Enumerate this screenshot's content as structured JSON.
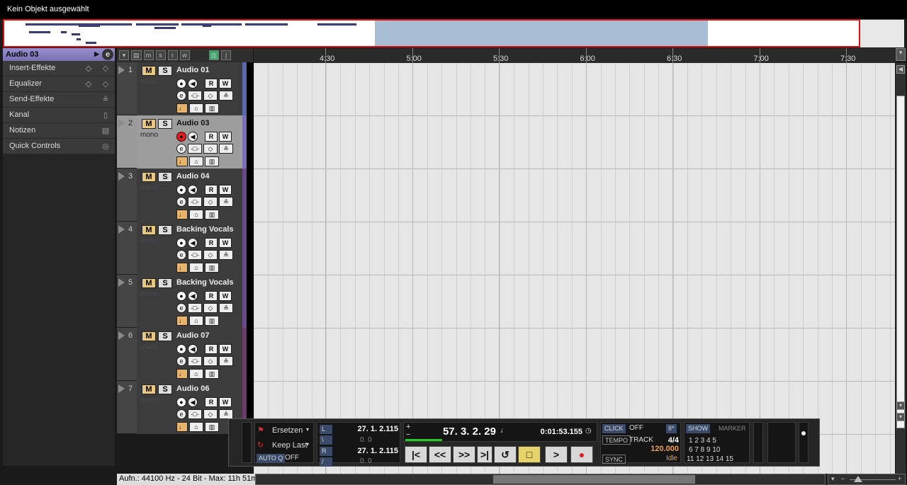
{
  "status_title": "Kein Objekt ausgewählt",
  "inspector": {
    "track_name": "Audio 03",
    "items": [
      {
        "label": "Insert-Effekte",
        "icon": "insert-icon"
      },
      {
        "label": "Equalizer",
        "icon": "eq-icon"
      },
      {
        "label": "Send-Effekte",
        "icon": "send-icon"
      },
      {
        "label": "Kanal",
        "icon": "channel-icon"
      },
      {
        "label": "Notizen",
        "icon": "notes-icon"
      },
      {
        "label": "Quick Controls",
        "icon": "quick-controls-icon"
      }
    ]
  },
  "toolbar": {
    "buttons": [
      "▾",
      "m",
      "s",
      "r",
      "w"
    ]
  },
  "ruler": {
    "labels": [
      "4:30",
      "5:00",
      "5:30",
      "6:00",
      "6:30",
      "7:00",
      "7:30"
    ]
  },
  "tracks": [
    {
      "num": "1",
      "name": "Audio 01",
      "mono": "mono",
      "color": "#5a6aa8",
      "selected": false,
      "rec": false
    },
    {
      "num": "2",
      "name": "Audio 03",
      "mono": "mono",
      "color": "#7b6fb6",
      "selected": true,
      "rec": true
    },
    {
      "num": "3",
      "name": "Audio 04",
      "mono": "mono",
      "color": "#6a4a8a",
      "selected": false,
      "rec": false
    },
    {
      "num": "4",
      "name": "Backing Vocals",
      "mono": "mono",
      "color": "#6a4a8a",
      "selected": false,
      "rec": false
    },
    {
      "num": "5",
      "name": "Backing Vocals",
      "mono": "mono",
      "color": "#6a4a8a",
      "selected": false,
      "rec": false
    },
    {
      "num": "6",
      "name": "Audio 07",
      "mono": "mono",
      "color": "#6a3a6a",
      "selected": false,
      "rec": false
    },
    {
      "num": "7",
      "name": "Audio 06",
      "mono": "mono",
      "color": "#6a3a6a",
      "selected": false,
      "rec": false
    }
  ],
  "track_buttons": {
    "m": "M",
    "s": "S",
    "r": "R",
    "w": "W"
  },
  "transport": {
    "mode1": "Ersetzen",
    "mode2": "Keep Last",
    "autoq": "AUTO Q",
    "autoq_state": "OFF",
    "left_locator": "27. 1. 2.115",
    "left_sub": "0.   0",
    "right_locator": "27. 1. 2.115",
    "right_sub": "0.   0",
    "position": "57. 3. 2. 29",
    "time": "0:01:53.155",
    "click": "CLICK",
    "click_state": "OFF",
    "tempo": "TEMPO",
    "track": "TRACK",
    "signature": "4/4",
    "bpm": "120.000",
    "sync": "SYNC",
    "sync_state": "Idle",
    "show": "SHOW",
    "marker": "MARKER",
    "markers_row1": "1   2   3   4   5",
    "markers_row2": "6   7   8   9  10",
    "markers_row3": "11 12  13  14  15"
  },
  "statusbar": "Aufn.: 44100 Hz - 24 Bit - Max: 11h 51m"
}
